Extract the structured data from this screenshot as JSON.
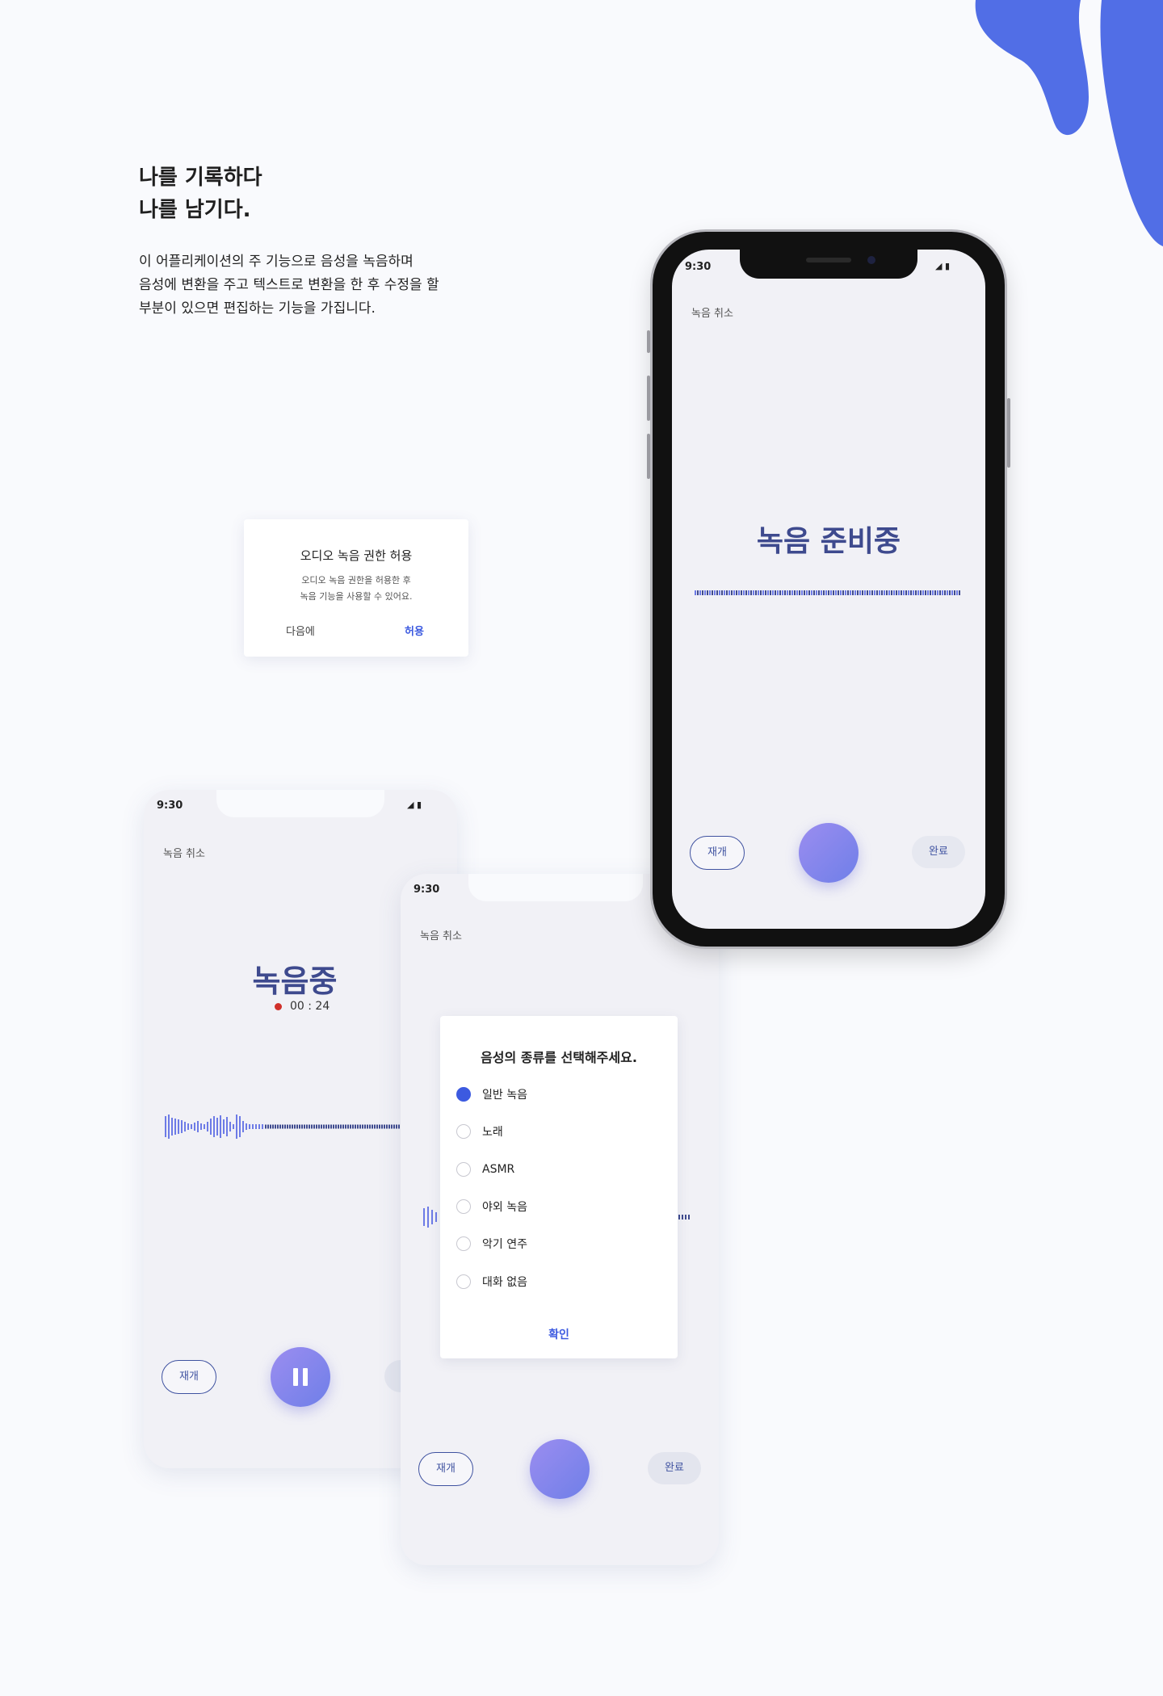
{
  "intro": {
    "headline": [
      "나를 기록하다",
      "나를 남기다."
    ],
    "body": [
      "이 어플리케이션의 주 기능으로 음성을 녹음하며",
      "음성에 변환을 주고 텍스트로 변환을 한 후 수정을 할",
      "부분이 있으면 편집하는 기능을 가집니다."
    ]
  },
  "permission_dialog": {
    "title": "오디오 녹음 권한 허용",
    "message": [
      "오디오 녹음 권한을 허용한 후",
      "녹음 기능을 사용할 수 있어요."
    ],
    "later": "다음에",
    "allow": "허용"
  },
  "ready_screen": {
    "time": "9:30",
    "cancel": "녹음 취소",
    "title": "녹음 준비중",
    "resume": "재개",
    "done": "완료"
  },
  "recording_screen": {
    "time": "9:30",
    "cancel": "녹음 취소",
    "title": "녹음중",
    "timer": "00 : 24",
    "resume": "재개"
  },
  "select_screen": {
    "time": "9:30",
    "cancel": "녹음 취소",
    "dialog_title": "음성의 종류를 선택해주세요.",
    "options": [
      "일반 녹음",
      "노래",
      "ASMR",
      "야외 녹음",
      "악기 연주",
      "대화 없음"
    ],
    "selected_index": 0,
    "confirm": "확인",
    "resume": "재개",
    "done": "완료"
  },
  "colors": {
    "accent": "#3c5ae0",
    "title": "#3e4a8e",
    "blob": "#516ee6",
    "record_dot": "#d0302a"
  }
}
